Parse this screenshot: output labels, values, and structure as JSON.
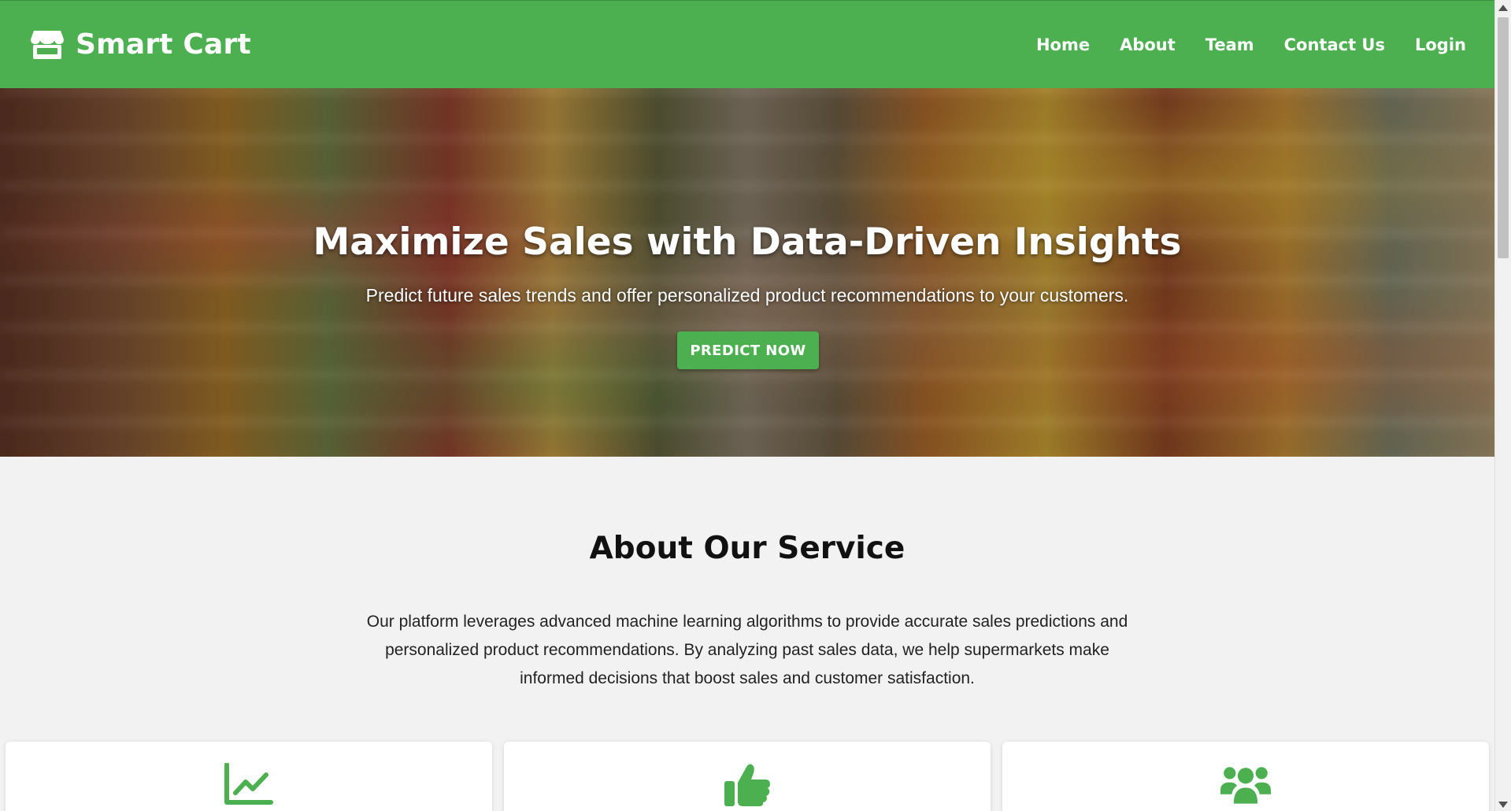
{
  "brand": {
    "name": "Smart Cart",
    "icon": "store-icon"
  },
  "nav": {
    "items": [
      {
        "label": "Home"
      },
      {
        "label": "About"
      },
      {
        "label": "Team"
      },
      {
        "label": "Contact Us"
      },
      {
        "label": "Login"
      }
    ]
  },
  "hero": {
    "title": "Maximize Sales with Data-Driven Insights",
    "subtitle": "Predict future sales trends and offer personalized product recommendations to your customers.",
    "button_label": "PREDICT NOW"
  },
  "about": {
    "title": "About Our Service",
    "text": "Our platform leverages advanced machine learning algorithms to provide accurate sales predictions and personalized product recommendations. By analyzing past sales data, we help supermarkets make informed decisions that boost sales and customer satisfaction."
  },
  "cards": [
    {
      "icon": "chart-line-icon"
    },
    {
      "icon": "thumbs-up-icon"
    },
    {
      "icon": "users-icon"
    }
  ],
  "colors": {
    "accent": "#4caf50",
    "page_background": "#f2f2f2",
    "card_background": "#ffffff"
  }
}
